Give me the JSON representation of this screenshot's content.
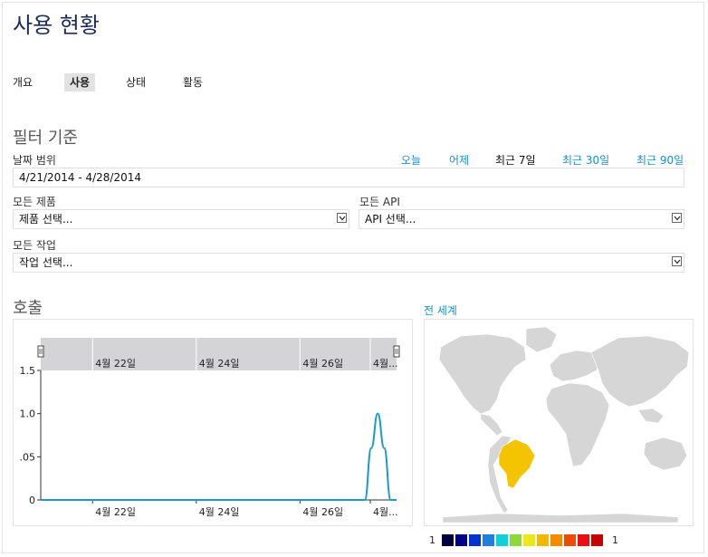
{
  "page": {
    "title": "사용 현황"
  },
  "tabs": [
    {
      "label": "개요"
    },
    {
      "label": "사용"
    },
    {
      "label": "상태"
    },
    {
      "label": "활동"
    }
  ],
  "filter": {
    "title": "필터 기준",
    "date_range_label": "날짜 범위",
    "date_range_value": "4/21/2014 - 4/28/2014",
    "quick_ranges": [
      "오늘",
      "어제",
      "최근 7일",
      "최근 30일",
      "최근 90일"
    ],
    "active_range": "최근 7일",
    "products_label": "모든 제품",
    "products_value": "제품 선택...",
    "api_label": "모든 API",
    "api_value": "API 선택...",
    "operations_label": "모든 작업",
    "operations_value": "작업 선택..."
  },
  "calls": {
    "title": "호출",
    "navigator_ticks": [
      "4월 22일",
      "4월 24일",
      "4월 26일",
      "4월..."
    ]
  },
  "map": {
    "title": "전 세계",
    "highlight_color": "#f5c400",
    "legend_min": "1",
    "legend_max": "1",
    "legend_colors": [
      "#000040",
      "#00008b",
      "#0033cc",
      "#1f7fe0",
      "#10cfd8",
      "#8fd83a",
      "#e8e81a",
      "#f5b800",
      "#f58c00",
      "#f04a00",
      "#e81010",
      "#c80000"
    ]
  },
  "chart_data": {
    "type": "line",
    "title": "",
    "xlabel": "",
    "ylabel": "",
    "x": [
      "4/21/2014",
      "4/22/2014",
      "4/23/2014",
      "4/24/2014",
      "4/25/2014",
      "4/26/2014",
      "4/27/2014",
      "4/27/2014 06:00",
      "4/27/2014 09:00",
      "4/27/2014 12:00",
      "4/27/2014 15:00",
      "4/27/2014 18:00",
      "4/28/2014"
    ],
    "series": [
      {
        "values": [
          0,
          0,
          0,
          0,
          0,
          0,
          0,
          0,
          0.6,
          1.0,
          0.6,
          0,
          0
        ],
        "color": "#1a9ac9"
      }
    ],
    "xticks": [
      "4월 22일",
      "4월 24일",
      "4월 26일",
      "4월..."
    ],
    "yticks": [
      "0",
      ".05",
      "1.0",
      "1.5"
    ],
    "ylim": [
      0,
      1.5
    ],
    "grid": false
  }
}
